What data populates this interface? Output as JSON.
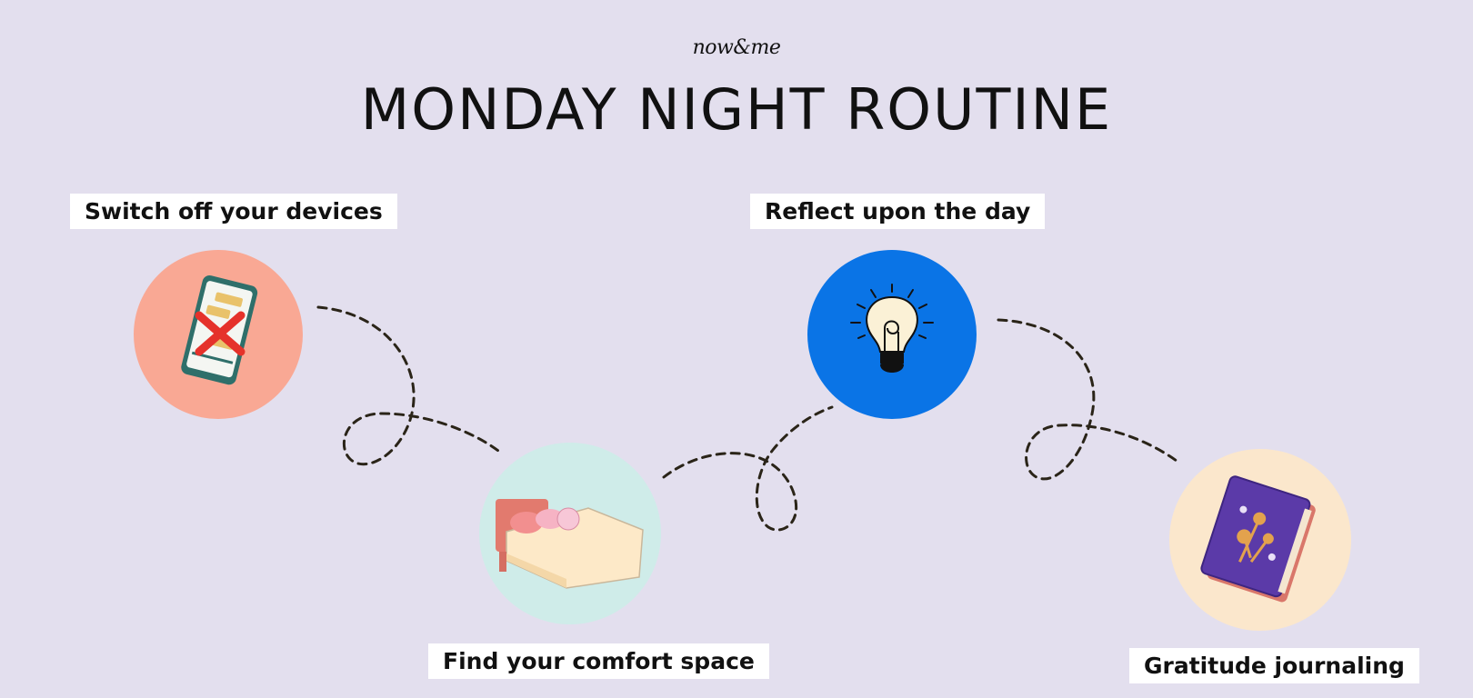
{
  "brand": "now&me",
  "title": "MONDAY NIGHT ROUTINE",
  "steps": [
    {
      "label": "Switch off your devices",
      "icon": "phone-off-icon",
      "color": "#f9a894"
    },
    {
      "label": "Find your comfort space",
      "icon": "bed-icon",
      "color": "#cfece9"
    },
    {
      "label": "Reflect upon the day",
      "icon": "lightbulb-icon",
      "color": "#0a74e6"
    },
    {
      "label": "Gratitude journaling",
      "icon": "journal-icon",
      "color": "#fbe7cc"
    }
  ]
}
